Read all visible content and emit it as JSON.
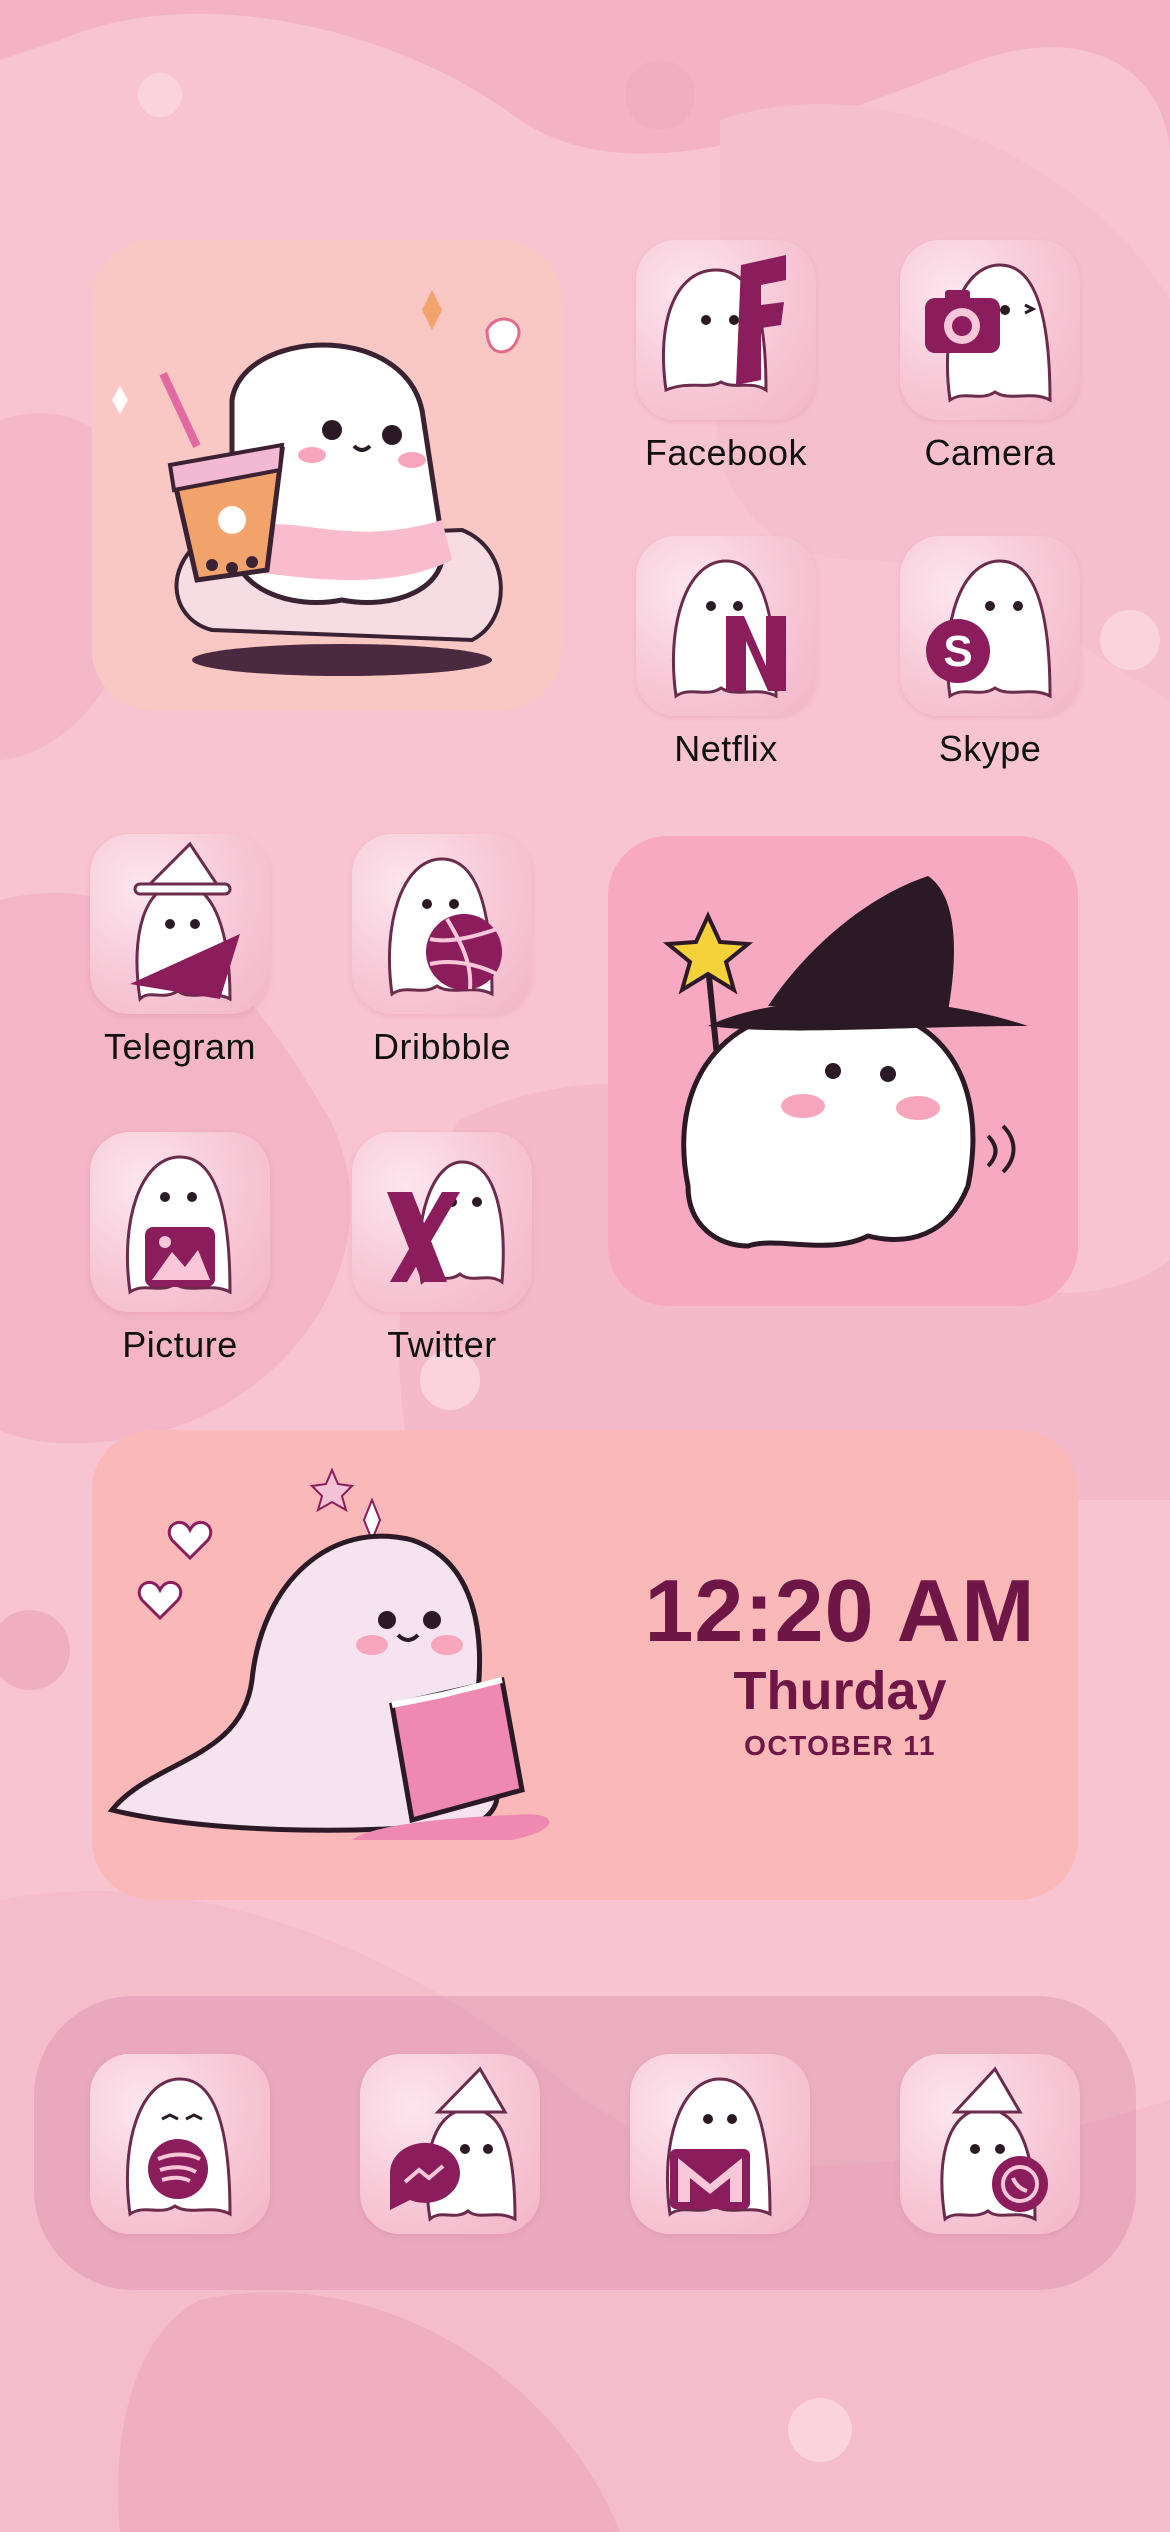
{
  "colors": {
    "background": "#f8c4d2",
    "accent": "#8b1d5c",
    "clock_text": "#6e1646",
    "label_text": "#111111"
  },
  "widgets": {
    "boba_ghost": {
      "icon": "ghost-boba-icon"
    },
    "witch_ghost": {
      "icon": "ghost-witch-wand-icon"
    },
    "clock": {
      "time": "12:20 AM",
      "day": "Thurday",
      "date": "OCTOBER 11",
      "icon": "ghost-reading-book-icon"
    }
  },
  "apps": [
    {
      "label": "Facebook",
      "icon": "facebook-icon"
    },
    {
      "label": "Camera",
      "icon": "camera-icon"
    },
    {
      "label": "Netflix",
      "icon": "netflix-icon"
    },
    {
      "label": "Skype",
      "icon": "skype-icon"
    },
    {
      "label": "Telegram",
      "icon": "telegram-icon"
    },
    {
      "label": "Dribbble",
      "icon": "dribbble-icon"
    },
    {
      "label": "Picture",
      "icon": "picture-icon"
    },
    {
      "label": "Twitter",
      "icon": "twitter-x-icon"
    }
  ],
  "dock": [
    {
      "icon": "spotify-icon"
    },
    {
      "icon": "messenger-icon"
    },
    {
      "icon": "gmail-icon"
    },
    {
      "icon": "whatsapp-icon"
    }
  ]
}
